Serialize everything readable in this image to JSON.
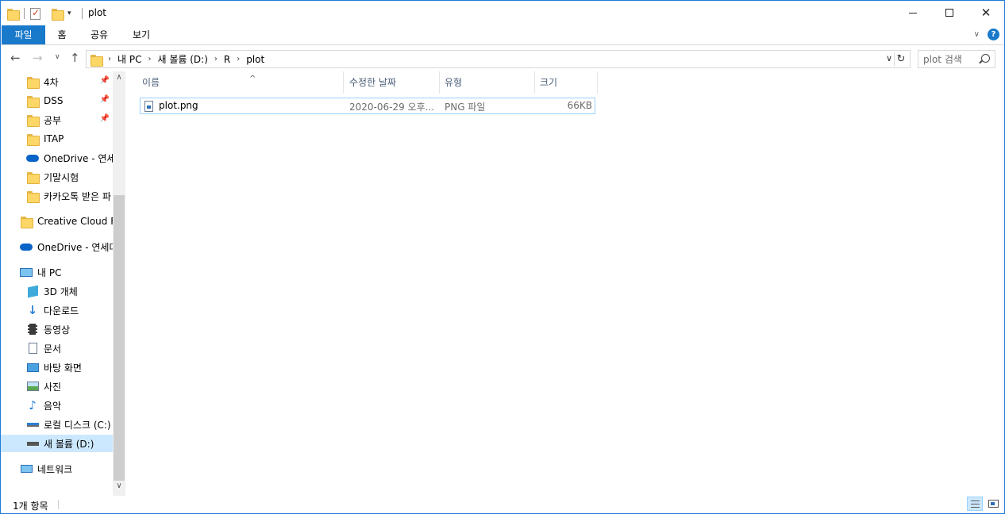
{
  "window": {
    "title": "plot"
  },
  "ribbon": {
    "tabs": [
      "파일",
      "홈",
      "공유",
      "보기"
    ]
  },
  "address": {
    "breadcrumbs": [
      "내 PC",
      "새 볼륨 (D:)",
      "R",
      "plot"
    ]
  },
  "search": {
    "placeholder": "plot 검색"
  },
  "nav": {
    "quick_access": [
      {
        "label": "4차",
        "icon": "folder-icon",
        "pinned": true
      },
      {
        "label": "DSS",
        "icon": "folder-icon",
        "pinned": true
      },
      {
        "label": "공부",
        "icon": "folder-icon",
        "pinned": true
      },
      {
        "label": "ITAP",
        "icon": "folder-icon",
        "pinned": false
      },
      {
        "label": "OneDrive - 연세",
        "icon": "onedrive-icon",
        "pinned": false
      },
      {
        "label": "기말시험",
        "icon": "folder-icon",
        "pinned": false
      },
      {
        "label": "카카오톡 받은 파",
        "icon": "folder-icon",
        "pinned": false
      }
    ],
    "creative_cloud": "Creative Cloud Fil",
    "onedrive": "OneDrive - 연세대",
    "this_pc": "내 PC",
    "this_pc_items": [
      {
        "label": "3D 개체",
        "icon": "3d-objects-icon"
      },
      {
        "label": "다운로드",
        "icon": "downloads-icon"
      },
      {
        "label": "동영상",
        "icon": "videos-icon"
      },
      {
        "label": "문서",
        "icon": "documents-icon"
      },
      {
        "label": "바탕 화면",
        "icon": "desktop-icon"
      },
      {
        "label": "사진",
        "icon": "pictures-icon"
      },
      {
        "label": "음악",
        "icon": "music-icon"
      },
      {
        "label": "로컬 디스크 (C:)",
        "icon": "local-disk-icon"
      },
      {
        "label": "새 볼륨 (D:)",
        "icon": "drive-icon",
        "selected": true
      }
    ],
    "network": "네트워크"
  },
  "columns": [
    "이름",
    "수정한 날짜",
    "유형",
    "크기"
  ],
  "files": [
    {
      "name": "plot.png",
      "modified": "2020-06-29 오후...",
      "type": "PNG 파일",
      "size": "66KB"
    }
  ],
  "status": {
    "item_count": "1개 항목"
  },
  "colors": {
    "accent": "#1979ca",
    "selection": "#cce8ff",
    "selection_border": "#99d1ff"
  }
}
